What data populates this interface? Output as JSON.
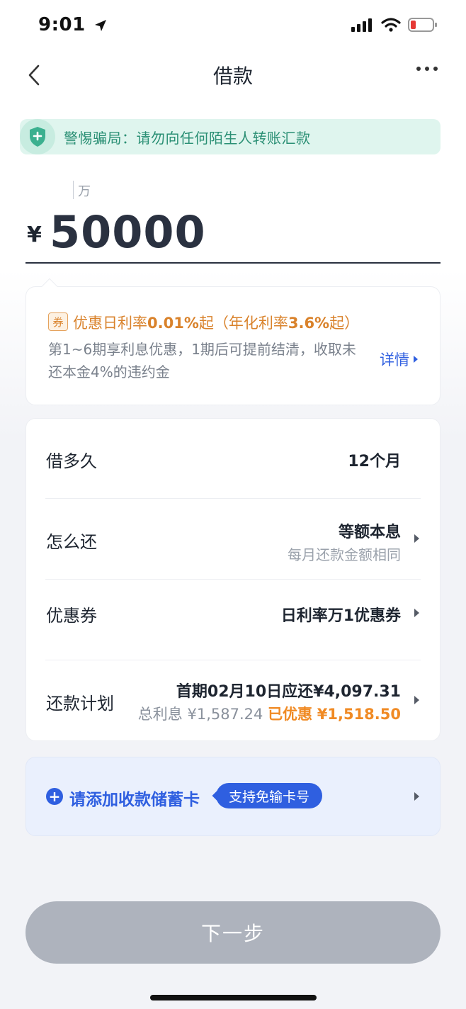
{
  "status": {
    "time": "9:01"
  },
  "nav": {
    "title": "借款"
  },
  "banner": {
    "text": "警惕骗局：请勿向任何陌生人转账汇款"
  },
  "amount": {
    "unit": "万",
    "currency": "¥",
    "value": "50000"
  },
  "promo": {
    "tag": "券",
    "rate_prefix": "优惠日利率",
    "rate_value": "0.01%",
    "rate_mid": "起（年化利率",
    "rate_annual": "3.6%",
    "rate_suffix": "起）",
    "desc": "第1~6期享利息优惠，1期后可提前结清，收取未还本金4%的违约金",
    "detail": "详情"
  },
  "rows": {
    "term": {
      "label": "借多久",
      "value": "12个月"
    },
    "repay": {
      "label": "怎么还",
      "value": "等额本息",
      "sub": "每月还款金额相同"
    },
    "coupon": {
      "label": "优惠券",
      "value": "日利率万1优惠券"
    },
    "plan": {
      "label": "还款计划",
      "value": "首期02月10日应还¥4,097.31",
      "interest_label": "总利息",
      "interest_value": "¥1,587.24",
      "discount_label": "已优惠",
      "discount_value": "¥1,518.50"
    }
  },
  "bank": {
    "label": "请添加收款储蓄卡",
    "badge": "支持免输卡号"
  },
  "next": {
    "label": "下一步"
  },
  "colors": {
    "accent": "#2f5fe0",
    "orange": "#f08a24",
    "green": "#2a8f74",
    "button_disabled": "#aeb3bd"
  }
}
